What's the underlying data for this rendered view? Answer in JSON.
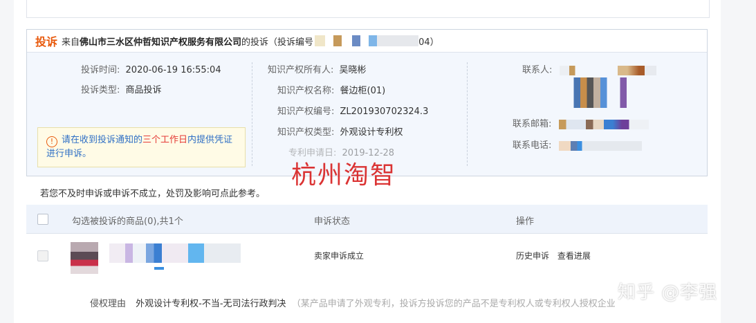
{
  "complaint": {
    "tag": "投诉",
    "prefix": "来自",
    "company": "佛山市三水区仲哲知识产权服务有限公司",
    "suffix": "的投诉（投诉编号",
    "suffix_end": "04）",
    "left": {
      "time_label": "投诉时间:",
      "time_value": "2020-06-19 16:55:04",
      "type_label": "投诉类型:",
      "type_value": "商品投诉",
      "notice_prefix": "请在收到投诉通知的",
      "notice_em": "三个工作日",
      "notice_suffix": "内提供凭证进行申诉。"
    },
    "middle": {
      "owner_label": "知识产权所有人:",
      "owner_value": "吴晓彬",
      "name_label": "知识产权名称:",
      "name_value": "餐边柜(01)",
      "number_label": "知识产权编号:",
      "number_value": "ZL201930702324.3",
      "iptype_label": "知识产权类型:",
      "iptype_value": "外观设计专利权",
      "apply_label": "专利申请日:",
      "apply_value": "2019-12-28"
    },
    "right": {
      "contact_label": "联系人:",
      "email_label": "联系邮箱:",
      "phone_label": "联系电话:"
    },
    "stamp_text": "杭州淘智"
  },
  "hint": "若您不及时申诉或申诉不成立，处罚及影响可点此参考。",
  "table": {
    "headers": [
      "勾选被投诉的商品(0),共1个",
      "申诉状态",
      "操作"
    ],
    "rows": [
      {
        "status": "卖家申诉成立",
        "actions": [
          "历史申诉",
          "查看进展"
        ]
      }
    ]
  },
  "reason": {
    "label": "侵权理由",
    "value": "外观设计专利权-不当-无司法行政判决",
    "note": "（某产品申请了外观专利，投诉方投诉您的产品不是专利权人或专利权人授权企业"
  },
  "watermark": "知乎 @李强",
  "colors": {
    "accent_orange": "#e8590c",
    "notice_blue": "#2f6fc5",
    "notice_red": "#e53935",
    "panel_bg": "#f3f7fd"
  },
  "icons": {
    "notice": "warning-circle-icon"
  }
}
